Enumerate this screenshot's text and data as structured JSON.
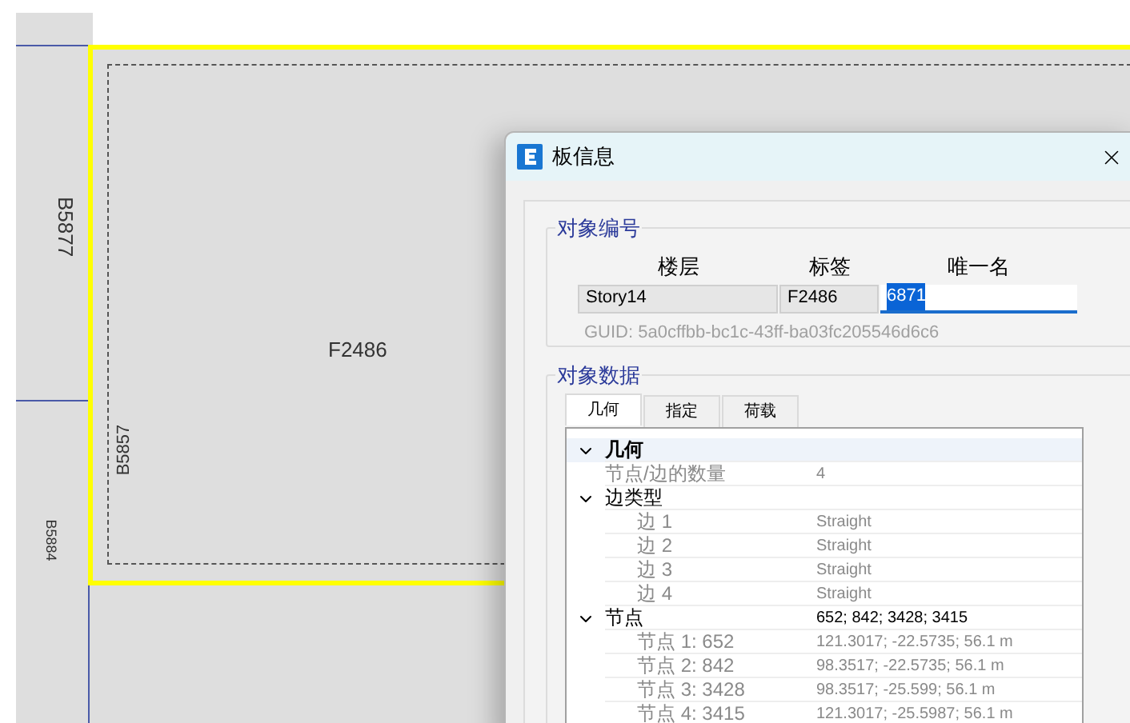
{
  "canvas": {
    "labels": [
      {
        "kind": "side",
        "text": "B5877"
      },
      {
        "kind": "center",
        "text": "F2486"
      },
      {
        "kind": "inner",
        "text": "B5857"
      },
      {
        "kind": "small",
        "text": "B5884"
      }
    ]
  },
  "dialog": {
    "title": "板信息",
    "id_group": {
      "legend": "对象编号",
      "columns": [
        "楼层",
        "标签",
        "唯一名"
      ],
      "fields": [
        {
          "value": "Story14",
          "editable": false,
          "selected": false
        },
        {
          "value": "F2486",
          "editable": false,
          "selected": false
        },
        {
          "value": "6871",
          "editable": true,
          "selected": true
        }
      ],
      "guid": "GUID:  5a0cffbb-bc1c-43ff-ba03fc205546d6c6"
    },
    "data_group": {
      "legend": "对象数据",
      "tabs": [
        {
          "label": "几何",
          "selected": true
        },
        {
          "label": "指定",
          "selected": false
        },
        {
          "label": "荷载",
          "selected": false
        }
      ],
      "tree": [
        {
          "label": "几何",
          "expanded": true,
          "readonly": false,
          "children": [
            {
              "label": "节点/边的数量",
              "value": "4",
              "readonly": true
            },
            {
              "label": "边类型",
              "expanded": true,
              "readonly": false,
              "children": [
                {
                  "label": "边 1",
                  "value": "Straight",
                  "readonly": true
                },
                {
                  "label": "边 2",
                  "value": "Straight",
                  "readonly": true
                },
                {
                  "label": "边 3",
                  "value": "Straight",
                  "readonly": true
                },
                {
                  "label": "边 4",
                  "value": "Straight",
                  "readonly": true
                }
              ]
            },
            {
              "label": "节点",
              "value": "652; 842; 3428; 3415",
              "expanded": true,
              "readonly": false,
              "children": [
                {
                  "label": "节点 1: 652",
                  "value": "121.3017; -22.5735; 56.1 m",
                  "readonly": true
                },
                {
                  "label": "节点 2: 842",
                  "value": "98.3517; -22.5735; 56.1 m",
                  "readonly": true
                },
                {
                  "label": "节点 3: 3428",
                  "value": "98.3517; -25.599; 56.1 m",
                  "readonly": true
                },
                {
                  "label": "节点 4: 3415",
                  "value": "121.3017; -25.5987; 56.1 m",
                  "readonly": true
                }
              ]
            }
          ]
        }
      ]
    }
  }
}
